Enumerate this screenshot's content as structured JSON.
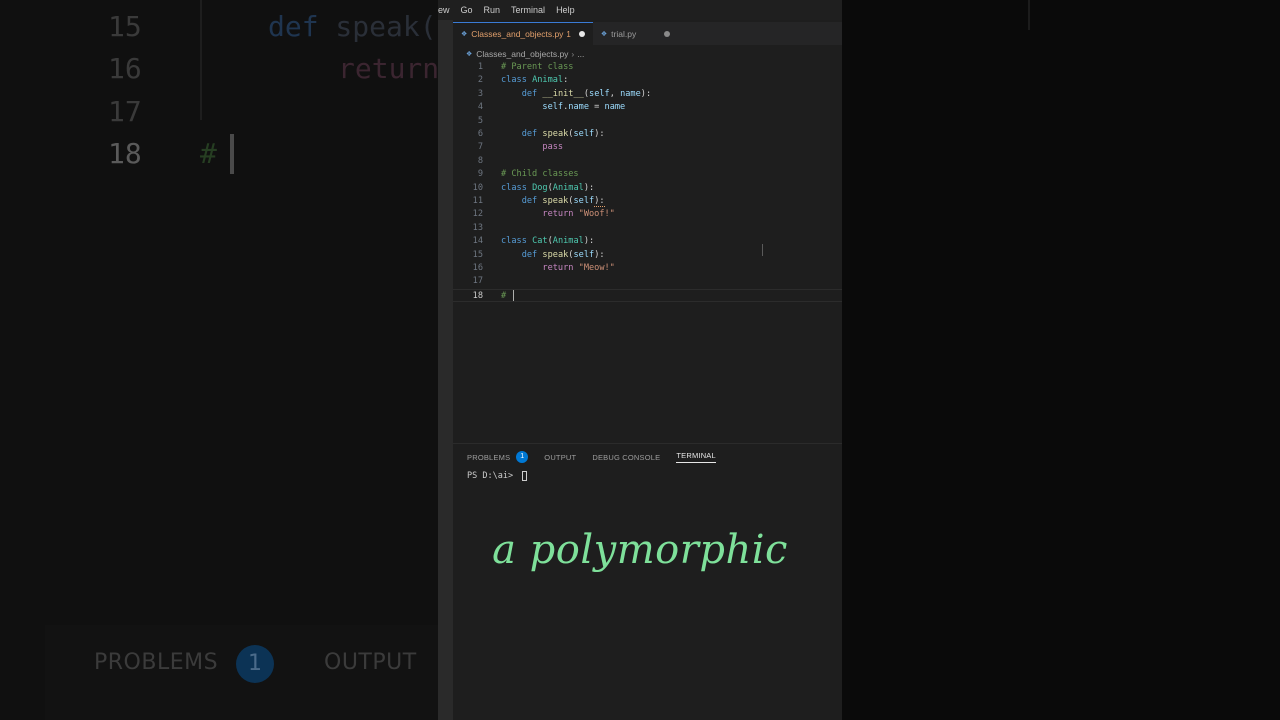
{
  "background": {
    "lines": [
      {
        "num": "15",
        "code_kw": "def",
        "code_rest": " speak("
      },
      {
        "num": "16",
        "code_kw": "",
        "code_rest": "return"
      },
      {
        "num": "17",
        "code_kw": "",
        "code_rest": ""
      },
      {
        "num": "18",
        "code_kw": "",
        "code_rest": "#"
      }
    ],
    "panel": {
      "problems": "PROBLEMS",
      "badge": "1",
      "output": "OUTPUT",
      "terminal_prompt": "PS D:\\ai> "
    }
  },
  "menubar": {
    "items": [
      "ew",
      "Go",
      "Run",
      "Terminal",
      "Help"
    ]
  },
  "tabs": [
    {
      "label": "Classes_and_objects.py",
      "modified": "1",
      "active": true
    },
    {
      "label": "trial.py",
      "modified": "",
      "active": false
    }
  ],
  "breadcrumb": {
    "file": "Classes_and_objects.py",
    "rest": "..."
  },
  "editor": {
    "lines": [
      {
        "n": "1"
      },
      {
        "n": "2"
      },
      {
        "n": "3"
      },
      {
        "n": "4"
      },
      {
        "n": "5"
      },
      {
        "n": "6"
      },
      {
        "n": "7"
      },
      {
        "n": "8"
      },
      {
        "n": "9"
      },
      {
        "n": "10"
      },
      {
        "n": "11"
      },
      {
        "n": "12"
      },
      {
        "n": "13"
      },
      {
        "n": "14"
      },
      {
        "n": "15"
      },
      {
        "n": "16"
      },
      {
        "n": "17"
      },
      {
        "n": "18"
      }
    ],
    "tokens": {
      "l1_com": "# Parent class",
      "l2_kw": "class",
      "l2_cls": "Animal",
      "l2_p": ":",
      "l3_kw": "def",
      "l3_fn": "__init__",
      "l3_p1": "(",
      "l3_v1": "self",
      "l3_p2": ", ",
      "l3_v2": "name",
      "l3_p3": "):",
      "l4_v1": "self",
      "l4_p1": ".",
      "l4_v2": "name",
      "l4_p2": " = ",
      "l4_v3": "name",
      "l6_kw": "def",
      "l6_fn": "speak",
      "l6_p1": "(",
      "l6_v1": "self",
      "l6_p2": "):",
      "l7_ctrl": "pass",
      "l9_com": "# Child classes",
      "l10_kw": "class",
      "l10_cls": "Dog",
      "l10_p1": "(",
      "l10_cls2": "Animal",
      "l10_p2": "):",
      "l11_kw": "def",
      "l11_fn": "speak",
      "l11_p1": "(",
      "l11_v1": "self",
      "l11_p2": "):",
      "l12_ctrl": "return",
      "l12_str": "\"Woof!\"",
      "l14_kw": "class",
      "l14_cls": "Cat",
      "l14_p1": "(",
      "l14_cls2": "Animal",
      "l14_p2": "):",
      "l15_kw": "def",
      "l15_fn": "speak",
      "l15_p1": "(",
      "l15_v1": "self",
      "l15_p2": "):",
      "l16_ctrl": "return",
      "l16_str": "\"Meow!\"",
      "l18_com": "#"
    }
  },
  "panel": {
    "tabs": [
      {
        "label": "PROBLEMS",
        "badge": "1"
      },
      {
        "label": "OUTPUT"
      },
      {
        "label": "DEBUG CONSOLE"
      },
      {
        "label": "TERMINAL",
        "active": true
      }
    ],
    "terminal_prompt": "PS D:\\ai> "
  },
  "caption": "a polymorphic",
  "colors": {
    "accent": "#0078d4",
    "caption": "#7ee09a",
    "modified_tab": "#e2a06c"
  }
}
